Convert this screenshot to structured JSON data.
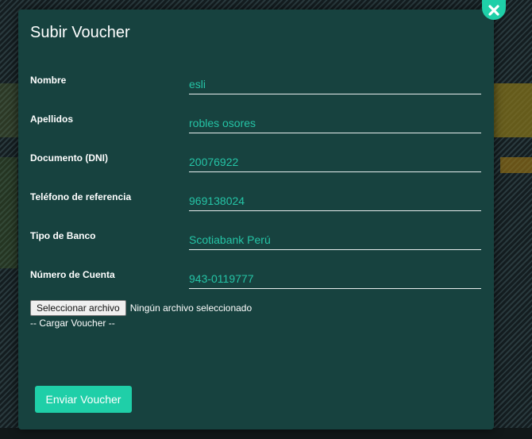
{
  "modal": {
    "title": "Subir Voucher",
    "close_icon": "close-x-icon",
    "fields": [
      {
        "label": "Nombre",
        "value": "esli"
      },
      {
        "label": "Apellidos",
        "value": "robles osores"
      },
      {
        "label": "Documento (DNI)",
        "value": "20076922"
      },
      {
        "label": "Teléfono de referencia",
        "value": "969138024"
      },
      {
        "label": "Tipo de Banco",
        "value": "Scotiabank Perú"
      },
      {
        "label": "Número de Cuenta",
        "value": "943-0119777"
      }
    ],
    "file_input": {
      "button_label": "Seleccionar archivo",
      "status_text": "Ningún archivo seleccionado",
      "caption": "-- Cargar Voucher --"
    },
    "submit_label": "Enviar Voucher"
  },
  "colors": {
    "accent": "#1fcfa8",
    "modal_bg": "#17423f",
    "input_text": "#25c4a6"
  }
}
